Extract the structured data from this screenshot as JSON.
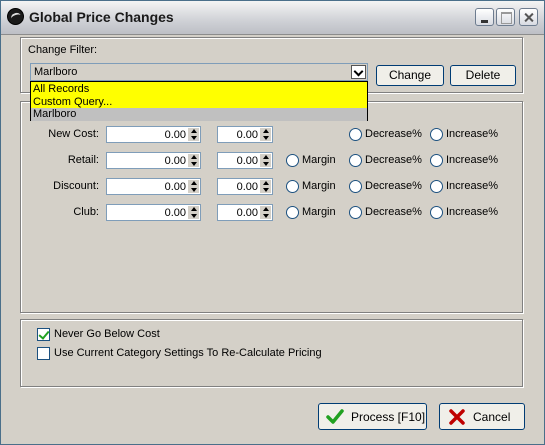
{
  "window": {
    "title": "Global Price Changes"
  },
  "filter": {
    "label": "Change Filter:",
    "selected": "Marlboro",
    "options": [
      "All Records",
      "Custom Query...",
      "Marlboro"
    ],
    "change_label": "Change",
    "delete_label": "Delete"
  },
  "rows": [
    {
      "label": "New Cost:",
      "value1": "0.00",
      "value2": "0.00",
      "margin": "",
      "decrease": "Decrease%",
      "increase": "Increase%"
    },
    {
      "label": "Retail:",
      "value1": "0.00",
      "value2": "0.00",
      "margin": "Margin",
      "decrease": "Decrease%",
      "increase": "Increase%"
    },
    {
      "label": "Discount:",
      "value1": "0.00",
      "value2": "0.00",
      "margin": "Margin",
      "decrease": "Decrease%",
      "increase": "Increase%"
    },
    {
      "label": "Club:",
      "value1": "0.00",
      "value2": "0.00",
      "margin": "Margin",
      "decrease": "Decrease%",
      "increase": "Increase%"
    }
  ],
  "options": {
    "never_below_cost": {
      "label": "Never Go Below Cost",
      "checked": true
    },
    "use_category": {
      "label": "Use Current Category Settings To Re-Calculate Pricing",
      "checked": false
    }
  },
  "footer": {
    "process_label": "Process  [F10]",
    "cancel_label": "Cancel"
  },
  "colors": {
    "dropdown_bg": "#ffff00",
    "face": "#d4d0c8",
    "check_green": "#21a121",
    "cancel_red": "#c00000"
  }
}
